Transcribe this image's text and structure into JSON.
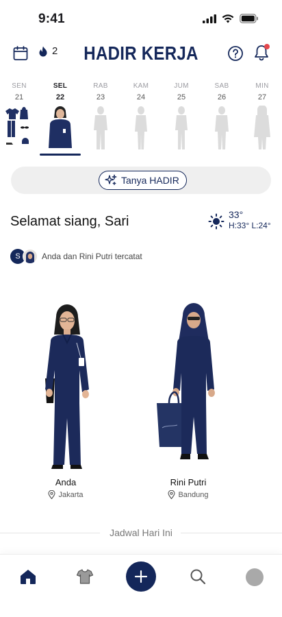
{
  "status_bar": {
    "time": "9:41"
  },
  "header": {
    "title": "HADIR KERJA",
    "streak_count": "2",
    "calendar_icon": "calendar-icon",
    "streak_icon": "flame-icon",
    "help_icon": "help-circle-icon",
    "notification_icon": "bell-icon",
    "notification_dot": true
  },
  "week": {
    "days": [
      {
        "name": "SEN",
        "date": "21",
        "state": "outfit-items"
      },
      {
        "name": "SEL",
        "date": "22",
        "state": "active"
      },
      {
        "name": "RAB",
        "date": "23",
        "state": "placeholder"
      },
      {
        "name": "KAM",
        "date": "24",
        "state": "placeholder"
      },
      {
        "name": "JUM",
        "date": "25",
        "state": "placeholder"
      },
      {
        "name": "SAB",
        "date": "26",
        "state": "placeholder"
      },
      {
        "name": "MIN",
        "date": "27",
        "state": "placeholder"
      }
    ]
  },
  "ask": {
    "label": "Tanya HADIR",
    "icon": "sparkle-icon"
  },
  "greeting": {
    "text": "Selamat siang, Sari"
  },
  "weather": {
    "icon": "sun-icon",
    "temp": "33°",
    "range": "H:33° L:24°"
  },
  "recorded": {
    "avatar_initial": "S",
    "text": "Anda dan Rini Putri tercatat"
  },
  "people": [
    {
      "name": "Anda",
      "location": "Jakarta"
    },
    {
      "name": "Rini Putri",
      "location": "Bandung"
    }
  ],
  "schedule": {
    "title": "Jadwal Hari Ini"
  },
  "nav": {
    "items": [
      "home-icon",
      "shirt-icon",
      "add-icon",
      "search-icon",
      "profile-avatar"
    ]
  },
  "colors": {
    "brand": "#14275a",
    "placeholder": "#d9d9d9",
    "notification": "#e5484d"
  }
}
